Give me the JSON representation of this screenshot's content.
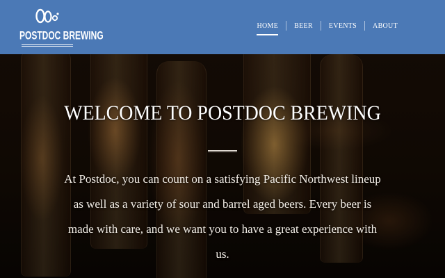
{
  "brand": {
    "name": "POSTDOC BREWING",
    "logo_icon": "bubbles-logo-icon"
  },
  "nav": {
    "items": [
      {
        "label": "HOME",
        "active": true
      },
      {
        "label": "BEER",
        "active": false
      },
      {
        "label": "EVENTS",
        "active": false
      },
      {
        "label": "ABOUT",
        "active": false
      }
    ]
  },
  "hero": {
    "title": "WELCOME TO POSTDOC BREWING",
    "text": "At Postdoc, you can count on a satisfying Pacific Northwest lineup as well as a variety of sour and barrel aged beers. Every beer is made with care, and we want you to have a great experience with us."
  },
  "colors": {
    "header_bg": "#4b79b6",
    "text": "#ffffff"
  }
}
